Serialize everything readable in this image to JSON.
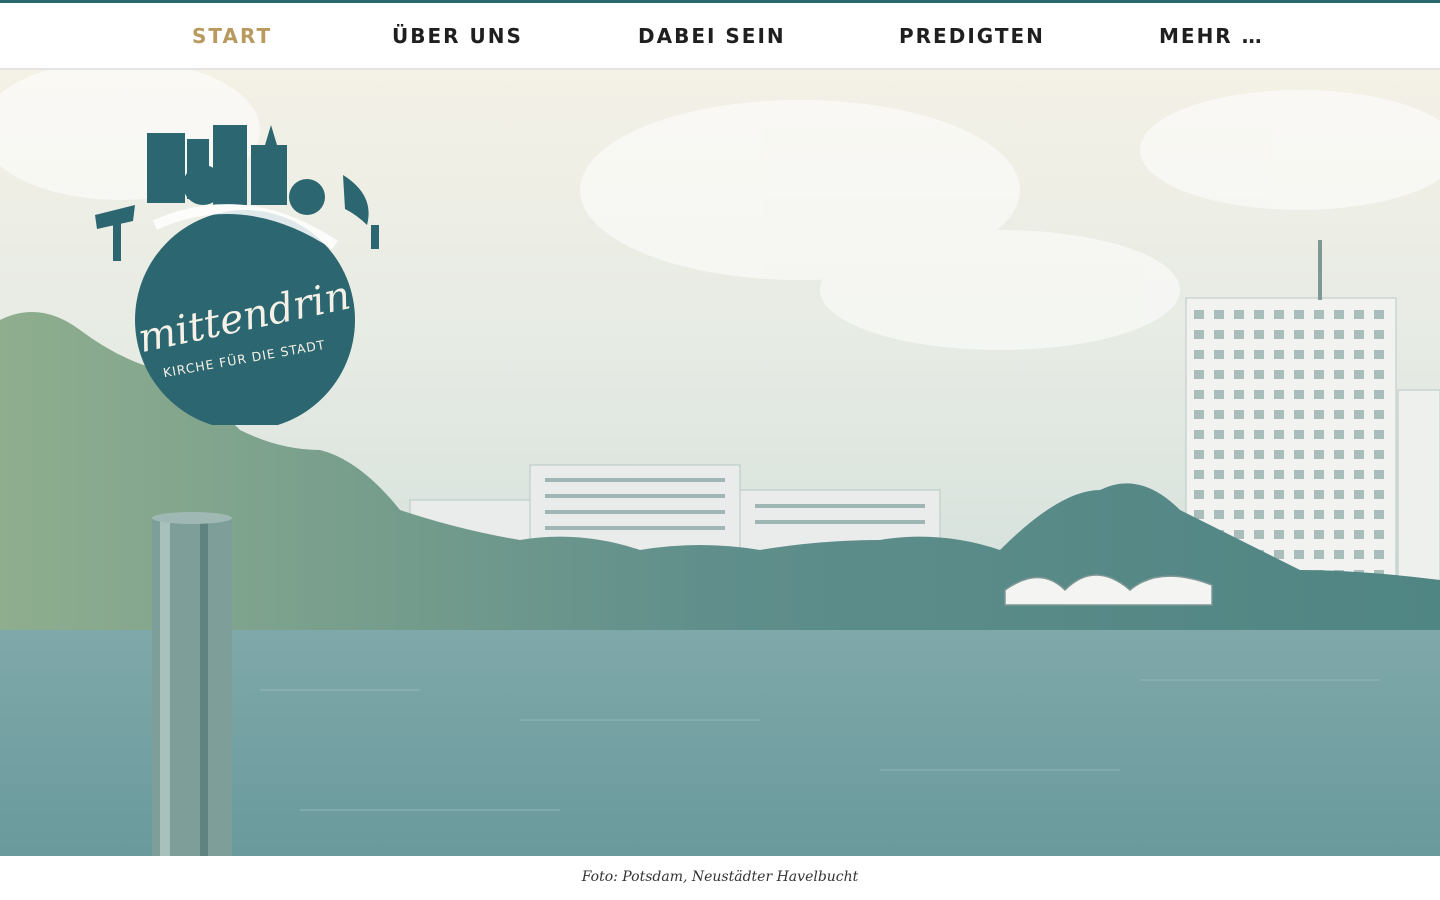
{
  "nav": {
    "items": [
      {
        "label": "START",
        "active": true
      },
      {
        "label": "ÜBER UNS",
        "active": false
      },
      {
        "label": "DABEI SEIN",
        "active": false
      },
      {
        "label": "PREDIGTEN",
        "active": false
      },
      {
        "label": "MEHR …",
        "active": false
      }
    ]
  },
  "logo": {
    "wordmark": "mittendrin",
    "tagline": "KIRCHE FÜR DIE STADT"
  },
  "hero": {
    "caption": "Foto: Potsdam, Neustädter Havelbucht"
  },
  "colors": {
    "accent_teal": "#2a6872",
    "active_gold": "#b89a5e",
    "nav_text": "#1f1f1f"
  }
}
